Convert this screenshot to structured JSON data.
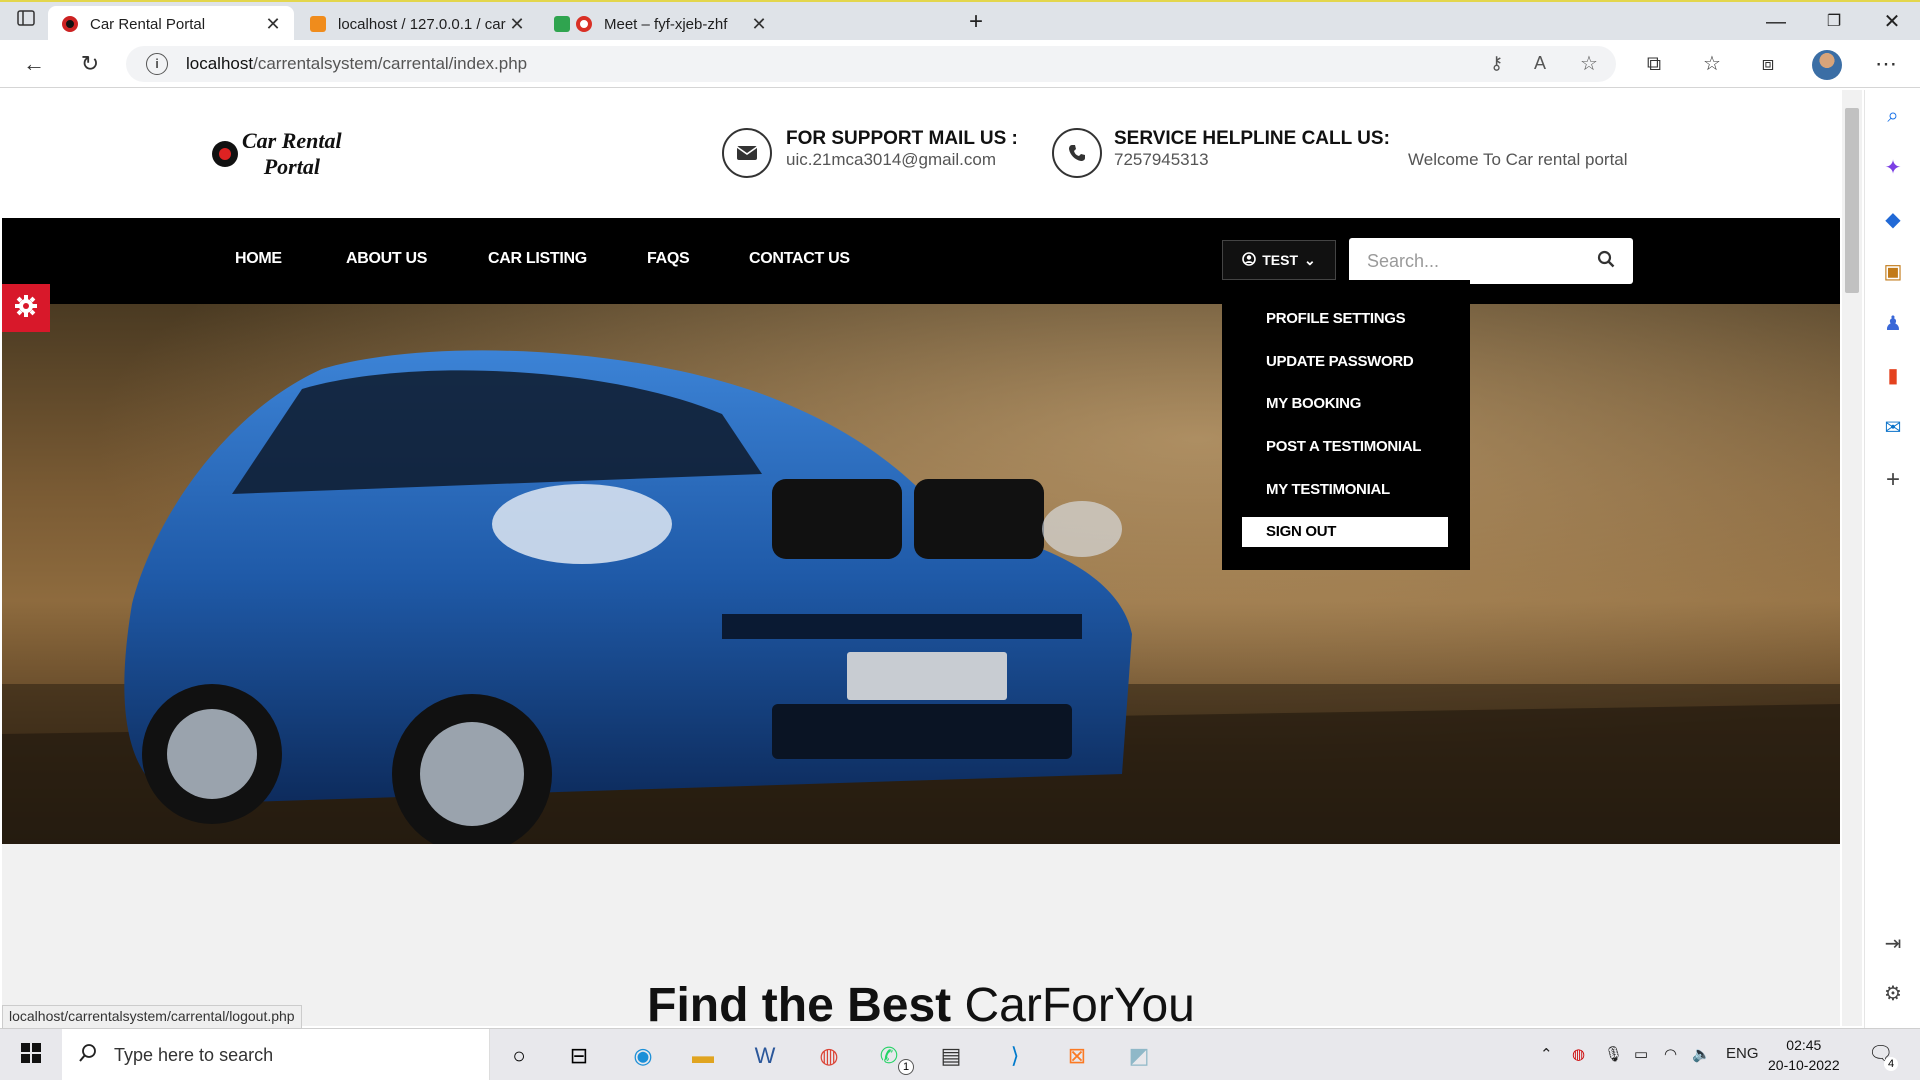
{
  "browser": {
    "tabs": [
      {
        "title": "Car Rental Portal",
        "active": true
      },
      {
        "title": "localhost / 127.0.0.1 / carrental /",
        "active": false
      },
      {
        "title": "Meet – fyf-xjeb-zhf",
        "active": false
      }
    ],
    "new_tab": "+",
    "url_host": "localhost",
    "url_path": "/carrentalsystem/carrental/index.php"
  },
  "site": {
    "logo_line1": "Car Rental",
    "logo_line2": "Portal",
    "support_title": "FOR SUPPORT MAIL US :",
    "support_email": "uic.21mca3014@gmail.com",
    "helpline_title": "SERVICE HELPLINE CALL US:",
    "helpline_phone": "7257945313",
    "welcome": "Welcome To Car rental portal"
  },
  "nav": {
    "items": [
      "HOME",
      "ABOUT US",
      "CAR LISTING",
      "FAQS",
      "CONTACT US"
    ],
    "user_label": "TEST",
    "search_placeholder": "Search..."
  },
  "dropdown": {
    "items": [
      "PROFILE SETTINGS",
      "UPDATE PASSWORD",
      "MY BOOKING",
      "POST A TESTIMONIAL",
      "MY TESTIMONIAL",
      "SIGN OUT"
    ],
    "active_index": 5
  },
  "section": {
    "heading_bold": "Find the Best",
    "heading_light": "CarForYou"
  },
  "statusbar": "localhost/carrentalsystem/carrental/logout.php",
  "taskbar": {
    "search_placeholder": "Type here to search",
    "language": "ENG",
    "time": "02:45",
    "date": "20-10-2022",
    "notification_count": "4",
    "whatsapp_badge": "1"
  },
  "colors": {
    "accent_red": "#d8182a",
    "navbar": "#000000",
    "car_blue": "#1f5aa8"
  }
}
